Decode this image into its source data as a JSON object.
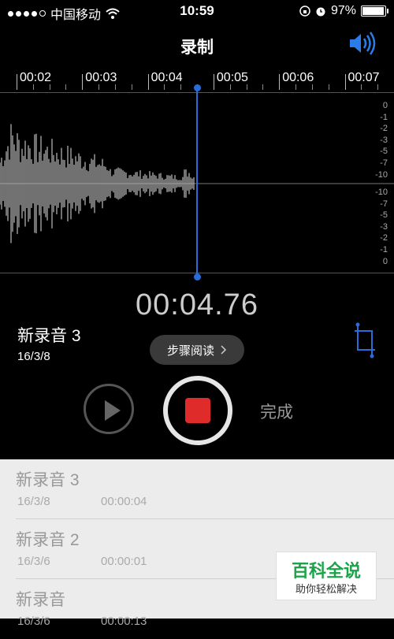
{
  "status_bar": {
    "carrier": "中国移动",
    "time": "10:59",
    "battery_percent": "97%",
    "battery_level": 0.97
  },
  "header": {
    "title": "录制",
    "speaker_icon": "speaker-volume-icon"
  },
  "timeline": {
    "labels": [
      "00:02",
      "00:03",
      "00:04",
      "00:05",
      "00:06",
      "00:07"
    ]
  },
  "level_scale": {
    "top": [
      "0",
      "-1",
      "-2",
      "-3",
      "-5",
      "-7",
      "-10"
    ],
    "bottom": [
      "-10",
      "-7",
      "-5",
      "-3",
      "-2",
      "-1",
      "0"
    ]
  },
  "recording": {
    "elapsed": "00:04.76",
    "name": "新录音 3",
    "date": "16/3/8"
  },
  "tooltip": {
    "label": "步骤阅读"
  },
  "controls": {
    "done_label": "完成"
  },
  "recordings_list": [
    {
      "name": "新录音 3",
      "date": "16/3/8",
      "duration": "00:00:04"
    },
    {
      "name": "新录音 2",
      "date": "16/3/6",
      "duration": "00:00:01"
    },
    {
      "name": "新录音",
      "date": "16/3/6",
      "duration": "00:00:13"
    }
  ],
  "watermark": {
    "title": "百科全说",
    "subtitle": "助你轻松解决"
  },
  "colors": {
    "accent_blue": "#2a6dd9",
    "record_red": "#e02b2b"
  }
}
